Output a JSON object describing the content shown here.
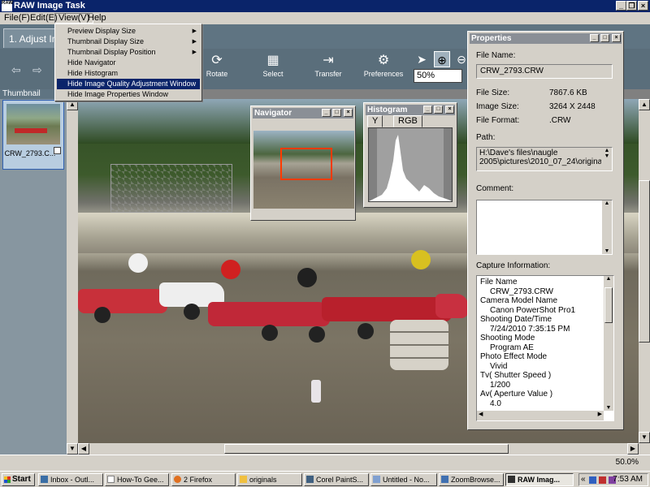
{
  "window": {
    "title": "RAW Image Task"
  },
  "menu": {
    "items": [
      "File(F)",
      "Edit(E)",
      "View(V)",
      "Help"
    ]
  },
  "view_menu": {
    "items": [
      {
        "label": "Preview Display Size",
        "submenu": true
      },
      {
        "label": "Thumbnail Display Size",
        "submenu": true
      },
      {
        "label": "Thumbnail Display Position",
        "submenu": true
      },
      {
        "label": "Hide Navigator",
        "submenu": false
      },
      {
        "label": "Hide Histogram",
        "submenu": false
      },
      {
        "label": "Hide Image Quality Adjustment Window",
        "submenu": false,
        "highlighted": true
      },
      {
        "label": "Hide Image Properties Window",
        "submenu": false
      }
    ]
  },
  "tabs": {
    "active": "1. Adjust Ima"
  },
  "toolbar": {
    "rotate": "Rotate",
    "select": "Select",
    "transfer": "Transfer",
    "preferences": "Preferences",
    "zoom_value": "50%"
  },
  "thumbnail_panel": {
    "header": "Thumbnail",
    "items": [
      {
        "caption": "CRW_2793.C..."
      }
    ]
  },
  "navigator": {
    "title": "Navigator"
  },
  "histogram": {
    "title": "Histogram",
    "tabs": [
      "Y",
      "RGB"
    ]
  },
  "properties": {
    "title": "Properties",
    "file_name_label": "File Name:",
    "file_name": "CRW_2793.CRW",
    "file_size_label": "File Size:",
    "file_size": "7867.6 KB",
    "image_size_label": "Image Size:",
    "image_size": "3264 X 2448",
    "file_format_label": "File Format:",
    "file_format": ".CRW",
    "path_label": "Path:",
    "path_line1": "H:\\Dave's files\\naugle",
    "path_line2": "2005\\pictures\\2010_07_24\\origina",
    "comment_label": "Comment:",
    "capture_label": "Capture Information:",
    "capture_lines": [
      {
        "text": "File Name",
        "indent": false
      },
      {
        "text": "CRW_2793.CRW",
        "indent": true
      },
      {
        "text": "Camera Model Name",
        "indent": false
      },
      {
        "text": "Canon PowerShot Pro1",
        "indent": true
      },
      {
        "text": "Shooting Date/Time",
        "indent": false
      },
      {
        "text": "7/24/2010 7:35:15 PM",
        "indent": true
      },
      {
        "text": "Shooting Mode",
        "indent": false
      },
      {
        "text": "Program AE",
        "indent": true
      },
      {
        "text": "Photo Effect Mode",
        "indent": false
      },
      {
        "text": "Vivid",
        "indent": true
      },
      {
        "text": "Tv( Shutter Speed )",
        "indent": false
      },
      {
        "text": "1/200",
        "indent": true
      },
      {
        "text": "Av( Aperture Value )",
        "indent": false
      },
      {
        "text": "4.0",
        "indent": true
      }
    ]
  },
  "status": {
    "zoom": "50.0%"
  },
  "taskbar": {
    "start": "Start",
    "tasks": [
      {
        "label": "Inbox - Outl..."
      },
      {
        "label": "How-To Gee..."
      },
      {
        "label": "2 Firefox"
      },
      {
        "label": "originals"
      },
      {
        "label": "Corel PaintS..."
      },
      {
        "label": "Untitled - No..."
      },
      {
        "label": "ZoomBrowse..."
      },
      {
        "label": "RAW Imag...",
        "active": true
      }
    ],
    "tray_prefix": "«",
    "clock": "7:53 AM"
  },
  "colors": {
    "title_bar": "#0a246a",
    "highlight": "#0a246a",
    "nav_rect": "#ff3a00",
    "toolbar_bg": "#5a6e7b"
  }
}
